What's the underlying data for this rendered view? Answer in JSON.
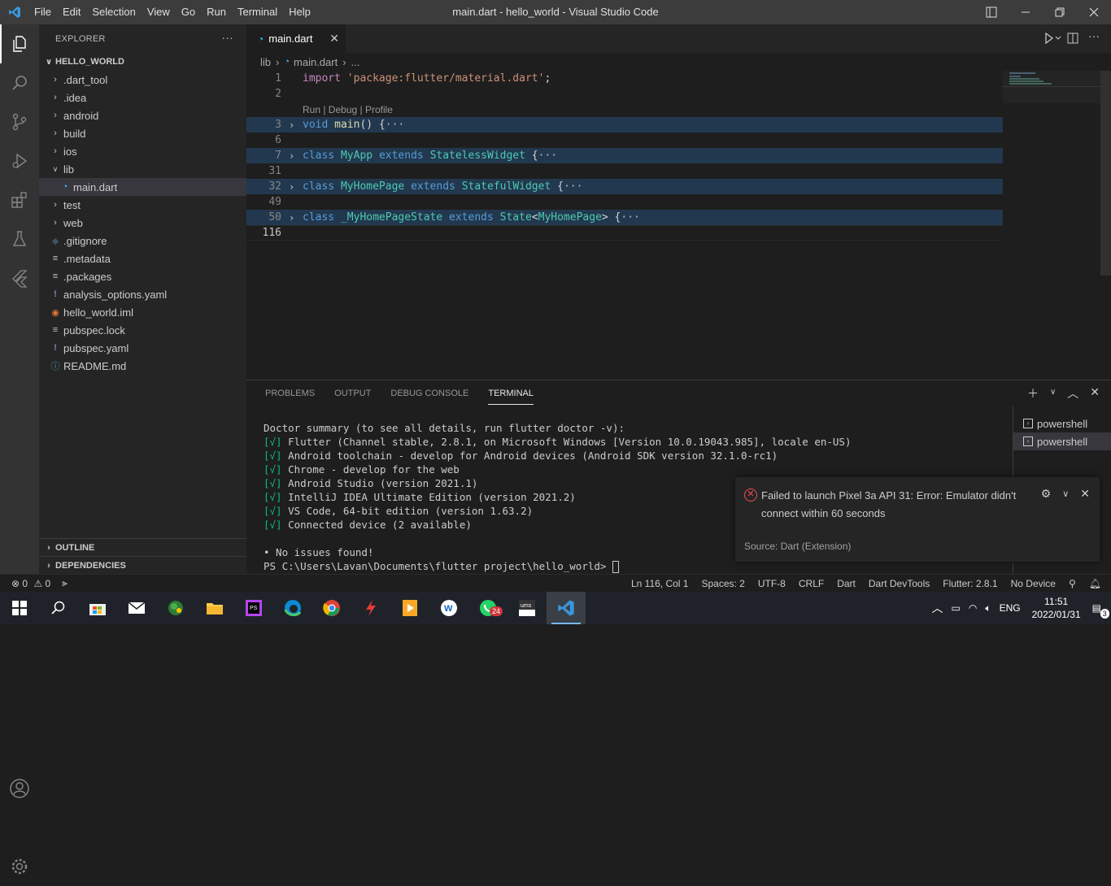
{
  "titlebar": {
    "menu": [
      "File",
      "Edit",
      "Selection",
      "View",
      "Go",
      "Run",
      "Terminal",
      "Help"
    ],
    "title": "main.dart - hello_world - Visual Studio Code"
  },
  "sidebar": {
    "header": "EXPLORER",
    "root": "HELLO_WORLD",
    "items": [
      {
        "label": ".dart_tool",
        "type": "folder"
      },
      {
        "label": ".idea",
        "type": "folder"
      },
      {
        "label": "android",
        "type": "folder"
      },
      {
        "label": "build",
        "type": "folder"
      },
      {
        "label": "ios",
        "type": "folder"
      },
      {
        "label": "lib",
        "type": "folder-open"
      },
      {
        "label": "main.dart",
        "type": "dart"
      },
      {
        "label": "test",
        "type": "folder"
      },
      {
        "label": "web",
        "type": "folder"
      },
      {
        "label": ".gitignore",
        "type": "gitignore"
      },
      {
        "label": ".metadata",
        "type": "file"
      },
      {
        "label": ".packages",
        "type": "file"
      },
      {
        "label": "analysis_options.yaml",
        "type": "yaml"
      },
      {
        "label": "hello_world.iml",
        "type": "rss"
      },
      {
        "label": "pubspec.lock",
        "type": "file"
      },
      {
        "label": "pubspec.yaml",
        "type": "yaml"
      },
      {
        "label": "README.md",
        "type": "info"
      }
    ],
    "outline": "OUTLINE",
    "dependencies": "DEPENDENCIES"
  },
  "editor": {
    "tab": "main.dart",
    "breadcrumb": {
      "folder": "lib",
      "file": "main.dart",
      "more": "..."
    },
    "codelens": "Run | Debug | Profile",
    "lines": [
      {
        "n": "1"
      },
      {
        "n": "2"
      },
      {
        "n": "3"
      },
      {
        "n": "6"
      },
      {
        "n": "7"
      },
      {
        "n": "31"
      },
      {
        "n": "32"
      },
      {
        "n": "49"
      },
      {
        "n": "50"
      },
      {
        "n": "116"
      }
    ],
    "code": {
      "l1_kw": "import",
      "l1_str": "'package:flutter/material.dart'",
      "l1_end": ";",
      "l3_kw": "void",
      "l3_fn": "main",
      "l3_rest": "() {",
      "l7_kw": "class",
      "l7_name": "MyApp",
      "l7_ext": "extends",
      "l7_base": "StatelessWidget",
      "l7_rest": " {",
      "l32_kw": "class",
      "l32_name": "MyHomePage",
      "l32_ext": "extends",
      "l32_base": "StatefulWidget",
      "l32_rest": " {",
      "l50_kw": "class",
      "l50_name": "_MyHomePageState",
      "l50_ext": "extends",
      "l50_base": "State",
      "l50_lt": "<",
      "l50_gen": "MyHomePage",
      "l50_rest": "> {",
      "ellipsis": "···"
    }
  },
  "panel": {
    "tabs": [
      "PROBLEMS",
      "OUTPUT",
      "DEBUG CONSOLE",
      "TERMINAL"
    ],
    "terminal_lines": [
      "Doctor summary (to see all details, run flutter doctor -v):",
      "Flutter (Channel stable, 2.8.1, on Microsoft Windows [Version 10.0.19043.985], locale en-US)",
      "Android toolchain - develop for Android devices (Android SDK version 32.1.0-rc1)",
      "Chrome - develop for the web",
      "Android Studio (version 2021.1)",
      "IntelliJ IDEA Ultimate Edition (version 2021.2)",
      "VS Code, 64-bit edition (version 1.63.2)",
      "Connected device (2 available)"
    ],
    "check": "[√]",
    "no_issues": "• No issues found!",
    "prompt": "PS C:\\Users\\Lavan\\Documents\\flutter project\\hello_world> ",
    "shells": [
      "powershell",
      "powershell"
    ]
  },
  "notification": {
    "message": "Failed to launch Pixel 3a API 31: Error: Emulator didn't connect within 60 seconds",
    "source": "Source: Dart (Extension)"
  },
  "statusbar": {
    "errors": "0",
    "warnings": "0",
    "position": "Ln 116, Col 1",
    "spaces": "Spaces: 2",
    "encoding": "UTF-8",
    "eol": "CRLF",
    "language": "Dart",
    "devtools": "Dart DevTools",
    "flutter": "Flutter: 2.8.1",
    "device": "No Device"
  },
  "taskbar": {
    "whatsapp_badge": "24",
    "lang": "ENG",
    "time": "11:51",
    "date": "2022/01/31",
    "notif_count": "3"
  },
  "colors": {
    "accent": "#007acc",
    "keyword": "#569cd6",
    "type": "#4ec9b0",
    "string": "#ce9178",
    "function": "#dcdcaa",
    "error": "#f14c4c",
    "ok": "#0dbc79"
  }
}
